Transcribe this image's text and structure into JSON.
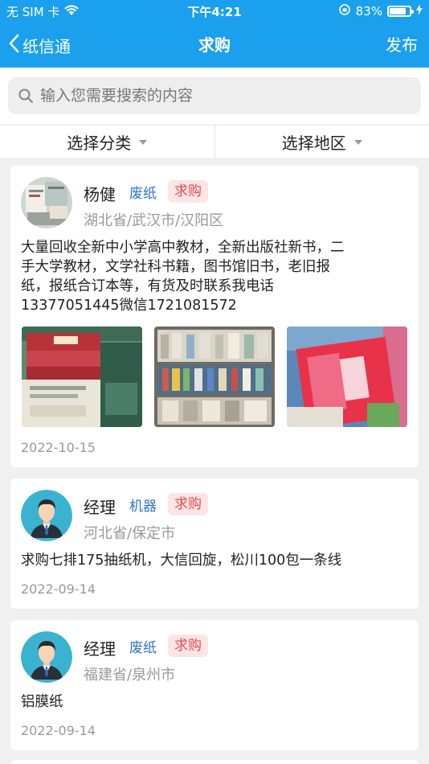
{
  "status_bar": {
    "carrier": "无 SIM 卡",
    "time": "下午4:21",
    "battery": "83%",
    "battery_level": 0.83
  },
  "nav": {
    "back_label": "纸信通",
    "title": "求购",
    "publish_label": "发布"
  },
  "search": {
    "placeholder": "输入您需要搜索的内容"
  },
  "filters": {
    "category_label": "选择分类",
    "region_label": "选择地区"
  },
  "posts": [
    {
      "name": "杨健",
      "category": "废纸",
      "tag": "求购",
      "region": "湖北省/武汉市/汉阳区",
      "desc_lines": [
        "大量回收全新中小学高中教材，全新出版社新书，二",
        "手大学教材，文学社科书籍，图书馆旧书，老旧报",
        "纸，报纸合订本等，有货及时联系我电话",
        "13377051445微信1721081572"
      ],
      "date": "2022-10-15",
      "photo_icons": [
        "textbook-stack-photo",
        "book-pile-photo",
        "textbook-cover-photo"
      ]
    },
    {
      "name": "经理",
      "category": "机器",
      "tag": "求购",
      "region": "河北省/保定市",
      "desc_lines": [
        "求购七排175抽纸机，大信回旋，松川100包一条线"
      ],
      "date": "2022-09-14"
    },
    {
      "name": "经理",
      "category": "废纸",
      "tag": "求购",
      "region": "福建省/泉州市",
      "desc_lines": [
        "铝膜纸"
      ],
      "date": "2022-09-14"
    }
  ],
  "colors": {
    "primary": "#1aa0ec",
    "tag_bg": "#fde5e6",
    "tag_text": "#e04b4f",
    "category_text": "#2c74c9"
  }
}
